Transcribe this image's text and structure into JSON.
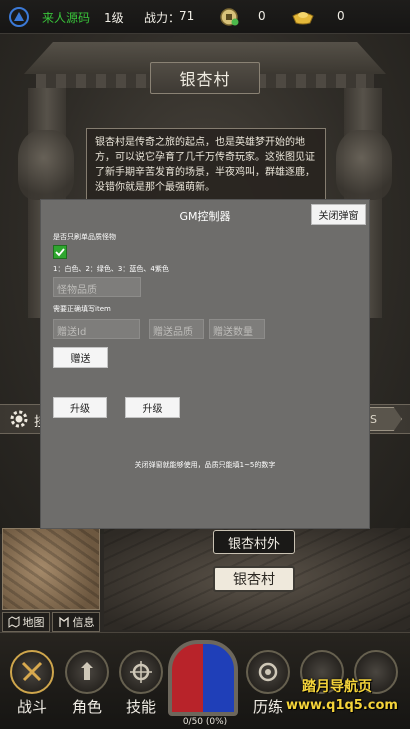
{
  "topbar": {
    "player_name": "来人源码",
    "level": "1级",
    "power_label": "战力：",
    "power_value": "71",
    "coin_value": "0",
    "ingot_value": "0",
    "name_color": "#39c43a"
  },
  "location": {
    "title": "银杏村",
    "description": "银杏村是传奇之旅的起点，也是英雄梦开始的地方，可以说它孕育了几千万传奇玩家。这张图见证了新手期辛苦发育的场景，半夜鸡叫，群雄逐鹿，没错你就是那个最强萌新。"
  },
  "strip": {
    "ghost_text": "挂",
    "right_text": "SS"
  },
  "gm_modal": {
    "title": "GM控制器",
    "close_label": "关闭弹窗",
    "only_quality_label": "是否只刷单品质怪物",
    "only_quality_checked": true,
    "quality_legend": "1：白色、2：绿色、3：蓝色、4紫色",
    "monster_quality_placeholder": "怪物品质",
    "item_hint": "需要正确填写item",
    "gift_id_placeholder": "赠送Id",
    "gift_quality_placeholder": "赠送品质",
    "gift_count_placeholder": "赠送数量",
    "gift_button": "赠送",
    "upgrade_button_1": "升级",
    "upgrade_button_2": "升级",
    "footer_note": "关闭弹窗就能够使用，品质只能填1~5的数字"
  },
  "map": {
    "map_button": "地图",
    "info_button": "信息",
    "sub_location": "银杏村外",
    "current_location": "银杏村"
  },
  "nav": {
    "items": [
      {
        "label": "战斗",
        "icon": "swords-icon",
        "active": true
      },
      {
        "label": "角色",
        "icon": "character-icon"
      },
      {
        "label": "技能",
        "icon": "skill-icon"
      },
      {
        "label": "历练",
        "icon": "training-icon"
      },
      {
        "label": "",
        "icon": "nav-5-icon"
      },
      {
        "label": "",
        "icon": "nav-6-icon"
      }
    ],
    "progress": "0/50 (0%)"
  },
  "watermark": {
    "line1": "踏月导航页",
    "line2": "www.q1q5.com"
  },
  "colors": {
    "accent_gold": "#cfa64c",
    "modal_bg": "#6e6d6b",
    "checkbox_green": "#2fa62f"
  }
}
